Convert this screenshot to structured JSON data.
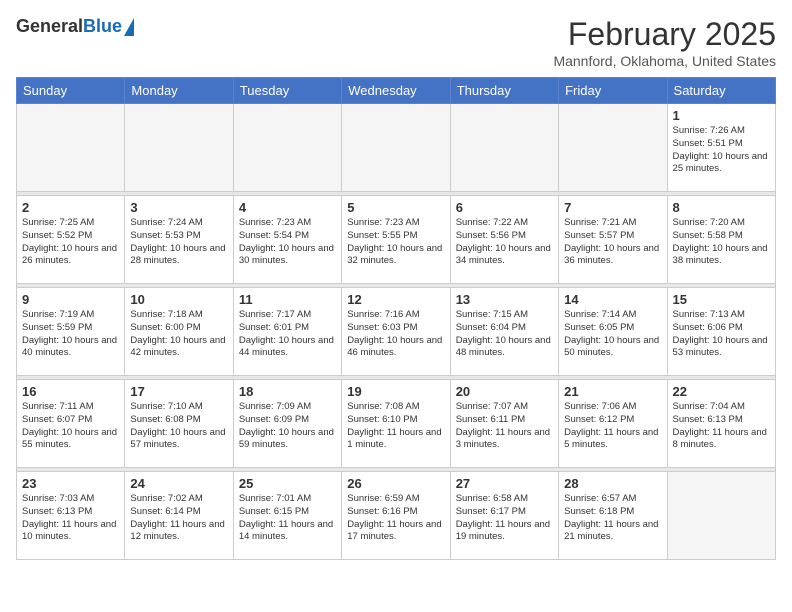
{
  "header": {
    "logo_general": "General",
    "logo_blue": "Blue",
    "month_title": "February 2025",
    "location": "Mannford, Oklahoma, United States"
  },
  "days_of_week": [
    "Sunday",
    "Monday",
    "Tuesday",
    "Wednesday",
    "Thursday",
    "Friday",
    "Saturday"
  ],
  "weeks": [
    [
      {
        "day": null
      },
      {
        "day": null
      },
      {
        "day": null
      },
      {
        "day": null
      },
      {
        "day": null
      },
      {
        "day": null
      },
      {
        "day": "1",
        "info": "Sunrise: 7:26 AM\nSunset: 5:51 PM\nDaylight: 10 hours and 25 minutes."
      }
    ],
    [
      {
        "day": "2",
        "info": "Sunrise: 7:25 AM\nSunset: 5:52 PM\nDaylight: 10 hours and 26 minutes."
      },
      {
        "day": "3",
        "info": "Sunrise: 7:24 AM\nSunset: 5:53 PM\nDaylight: 10 hours and 28 minutes."
      },
      {
        "day": "4",
        "info": "Sunrise: 7:23 AM\nSunset: 5:54 PM\nDaylight: 10 hours and 30 minutes."
      },
      {
        "day": "5",
        "info": "Sunrise: 7:23 AM\nSunset: 5:55 PM\nDaylight: 10 hours and 32 minutes."
      },
      {
        "day": "6",
        "info": "Sunrise: 7:22 AM\nSunset: 5:56 PM\nDaylight: 10 hours and 34 minutes."
      },
      {
        "day": "7",
        "info": "Sunrise: 7:21 AM\nSunset: 5:57 PM\nDaylight: 10 hours and 36 minutes."
      },
      {
        "day": "8",
        "info": "Sunrise: 7:20 AM\nSunset: 5:58 PM\nDaylight: 10 hours and 38 minutes."
      }
    ],
    [
      {
        "day": "9",
        "info": "Sunrise: 7:19 AM\nSunset: 5:59 PM\nDaylight: 10 hours and 40 minutes."
      },
      {
        "day": "10",
        "info": "Sunrise: 7:18 AM\nSunset: 6:00 PM\nDaylight: 10 hours and 42 minutes."
      },
      {
        "day": "11",
        "info": "Sunrise: 7:17 AM\nSunset: 6:01 PM\nDaylight: 10 hours and 44 minutes."
      },
      {
        "day": "12",
        "info": "Sunrise: 7:16 AM\nSunset: 6:03 PM\nDaylight: 10 hours and 46 minutes."
      },
      {
        "day": "13",
        "info": "Sunrise: 7:15 AM\nSunset: 6:04 PM\nDaylight: 10 hours and 48 minutes."
      },
      {
        "day": "14",
        "info": "Sunrise: 7:14 AM\nSunset: 6:05 PM\nDaylight: 10 hours and 50 minutes."
      },
      {
        "day": "15",
        "info": "Sunrise: 7:13 AM\nSunset: 6:06 PM\nDaylight: 10 hours and 53 minutes."
      }
    ],
    [
      {
        "day": "16",
        "info": "Sunrise: 7:11 AM\nSunset: 6:07 PM\nDaylight: 10 hours and 55 minutes."
      },
      {
        "day": "17",
        "info": "Sunrise: 7:10 AM\nSunset: 6:08 PM\nDaylight: 10 hours and 57 minutes."
      },
      {
        "day": "18",
        "info": "Sunrise: 7:09 AM\nSunset: 6:09 PM\nDaylight: 10 hours and 59 minutes."
      },
      {
        "day": "19",
        "info": "Sunrise: 7:08 AM\nSunset: 6:10 PM\nDaylight: 11 hours and 1 minute."
      },
      {
        "day": "20",
        "info": "Sunrise: 7:07 AM\nSunset: 6:11 PM\nDaylight: 11 hours and 3 minutes."
      },
      {
        "day": "21",
        "info": "Sunrise: 7:06 AM\nSunset: 6:12 PM\nDaylight: 11 hours and 5 minutes."
      },
      {
        "day": "22",
        "info": "Sunrise: 7:04 AM\nSunset: 6:13 PM\nDaylight: 11 hours and 8 minutes."
      }
    ],
    [
      {
        "day": "23",
        "info": "Sunrise: 7:03 AM\nSunset: 6:13 PM\nDaylight: 11 hours and 10 minutes."
      },
      {
        "day": "24",
        "info": "Sunrise: 7:02 AM\nSunset: 6:14 PM\nDaylight: 11 hours and 12 minutes."
      },
      {
        "day": "25",
        "info": "Sunrise: 7:01 AM\nSunset: 6:15 PM\nDaylight: 11 hours and 14 minutes."
      },
      {
        "day": "26",
        "info": "Sunrise: 6:59 AM\nSunset: 6:16 PM\nDaylight: 11 hours and 17 minutes."
      },
      {
        "day": "27",
        "info": "Sunrise: 6:58 AM\nSunset: 6:17 PM\nDaylight: 11 hours and 19 minutes."
      },
      {
        "day": "28",
        "info": "Sunrise: 6:57 AM\nSunset: 6:18 PM\nDaylight: 11 hours and 21 minutes."
      },
      {
        "day": null
      }
    ]
  ]
}
